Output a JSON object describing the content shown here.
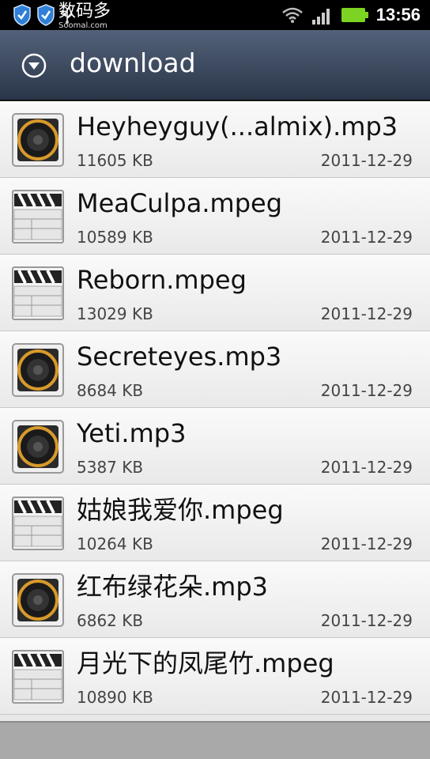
{
  "status_bar": {
    "time": "13:56",
    "icons": [
      "shield-icon",
      "shield-icon",
      "usb-icon",
      "wifi-icon",
      "signal-icon",
      "battery-icon"
    ]
  },
  "watermark": {
    "main": "数码多",
    "sub": "Soomal.com"
  },
  "header": {
    "title": "download",
    "dropdown_icon": "chevron-down-icon"
  },
  "files": [
    {
      "icon": "audio-file-icon",
      "name": "Heyheyguy(...almix).mp3",
      "size": "11605 KB",
      "date": "2011-12-29"
    },
    {
      "icon": "video-file-icon",
      "name": "MeaCulpa.mpeg",
      "size": "10589 KB",
      "date": "2011-12-29"
    },
    {
      "icon": "video-file-icon",
      "name": "Reborn.mpeg",
      "size": "13029 KB",
      "date": "2011-12-29"
    },
    {
      "icon": "audio-file-icon",
      "name": "Secreteyes.mp3",
      "size": "8684 KB",
      "date": "2011-12-29"
    },
    {
      "icon": "audio-file-icon",
      "name": "Yeti.mp3",
      "size": "5387 KB",
      "date": "2011-12-29"
    },
    {
      "icon": "video-file-icon",
      "name": "姑娘我爱你.mpeg",
      "size": "10264 KB",
      "date": "2011-12-29"
    },
    {
      "icon": "audio-file-icon",
      "name": "红布绿花朵.mp3",
      "size": "6862 KB",
      "date": "2011-12-29"
    },
    {
      "icon": "video-file-icon",
      "name": "月光下的凤尾竹.mpeg",
      "size": "10890 KB",
      "date": "2011-12-29"
    }
  ],
  "colors": {
    "statusbar": "#000000",
    "titlebar_top": "#53627a",
    "titlebar_bottom": "#2a3548",
    "battery": "#7cd321",
    "speaker_ring": "#d89a2a"
  }
}
